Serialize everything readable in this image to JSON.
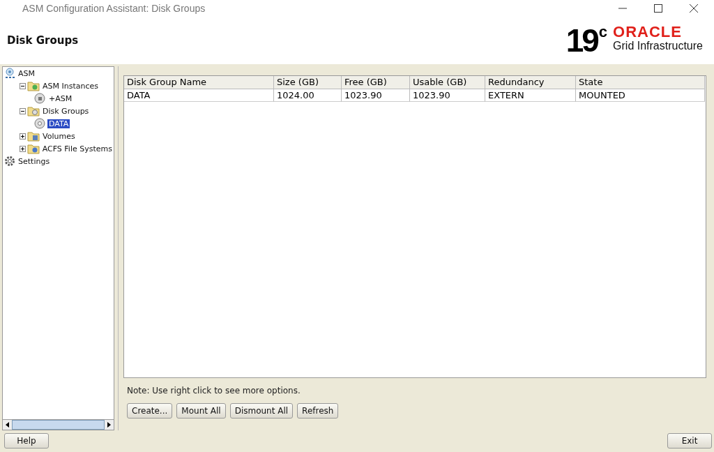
{
  "window": {
    "title": "ASM Configuration Assistant: Disk Groups"
  },
  "header": {
    "title": "Disk Groups",
    "logo": {
      "version": "19",
      "version_mark": "c",
      "brand": "ORACLE",
      "product": "Grid Infrastructure"
    }
  },
  "tree": [
    {
      "label": "ASM",
      "kind": "root",
      "selected": false,
      "children": [
        {
          "label": "ASM Instances",
          "kind": "instances",
          "expanded": true,
          "selected": false,
          "children": [
            {
              "label": "+ASM",
              "kind": "instance",
              "selected": false
            }
          ]
        },
        {
          "label": "Disk Groups",
          "kind": "diskgroups",
          "expanded": true,
          "selected": false,
          "children": [
            {
              "label": "DATA",
              "kind": "diskgroup",
              "selected": true
            }
          ]
        },
        {
          "label": "Volumes",
          "kind": "volumes",
          "expanded": false,
          "selected": false
        },
        {
          "label": "ACFS File Systems",
          "kind": "acfs",
          "expanded": false,
          "selected": false
        }
      ]
    },
    {
      "label": "Settings",
      "kind": "settings",
      "selected": false
    }
  ],
  "table": {
    "columns": [
      "Disk Group Name",
      "Size (GB)",
      "Free (GB)",
      "Usable (GB)",
      "Redundancy",
      "State"
    ],
    "rows": [
      [
        "DATA",
        "1024.00",
        "1023.90",
        "1023.90",
        "EXTERN",
        "MOUNTED"
      ]
    ]
  },
  "note": "Note: Use right click to see more options.",
  "buttons": [
    "Create...",
    "Mount All",
    "Dismount All",
    "Refresh"
  ],
  "footer": {
    "help": "Help",
    "exit": "Exit"
  }
}
